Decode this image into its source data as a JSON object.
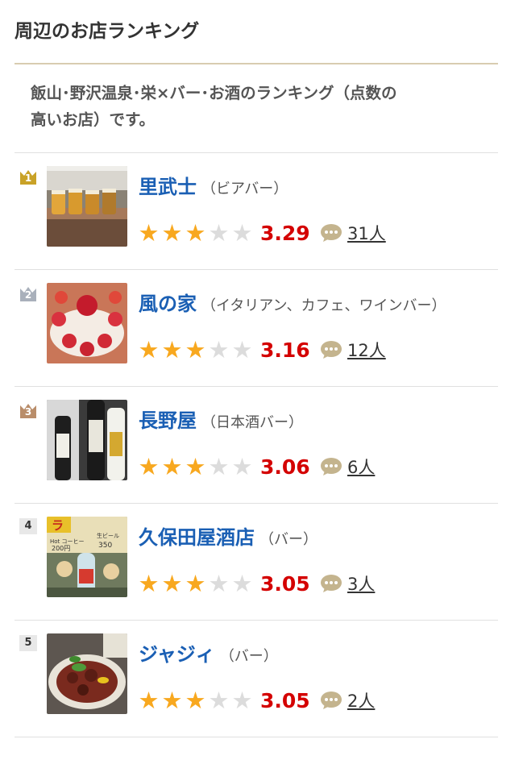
{
  "heading": "周辺のお店ランキング",
  "description": {
    "line1": "飯山･野沢温泉･栄×バー･お酒のランキング（点数の",
    "line2": "高いお店）です。"
  },
  "colors": {
    "name_link": "#1a5fb4",
    "score": "#d40000",
    "star_on": "#f8a81f",
    "star_off": "#dcdcdc",
    "gold": "#c9a227",
    "silver": "#a9b0bb",
    "bronze": "#b98d6a"
  },
  "ranking": [
    {
      "rank": "1",
      "name": "里武士",
      "genre": "（ビアバー）",
      "score": "3.29",
      "reviews": "31人",
      "stars_filled": 3
    },
    {
      "rank": "2",
      "name": "風の家",
      "genre": "（イタリアン、カフェ、ワインバー）",
      "score": "3.16",
      "reviews": "12人",
      "stars_filled": 3
    },
    {
      "rank": "3",
      "name": "長野屋",
      "genre": "（日本酒バー）",
      "score": "3.06",
      "reviews": "6人",
      "stars_filled": 3
    },
    {
      "rank": "4",
      "name": "久保田屋酒店",
      "genre": "（バー）",
      "score": "3.05",
      "reviews": "3人",
      "stars_filled": 3
    },
    {
      "rank": "5",
      "name": "ジャジィ",
      "genre": "（バー）",
      "score": "3.05",
      "reviews": "2人",
      "stars_filled": 3
    }
  ],
  "thumb4_sign": {
    "text1": "ラ",
    "text2": "Hot コーヒー",
    "price1": "200円",
    "text3": "生ビール",
    "price2": "350"
  }
}
